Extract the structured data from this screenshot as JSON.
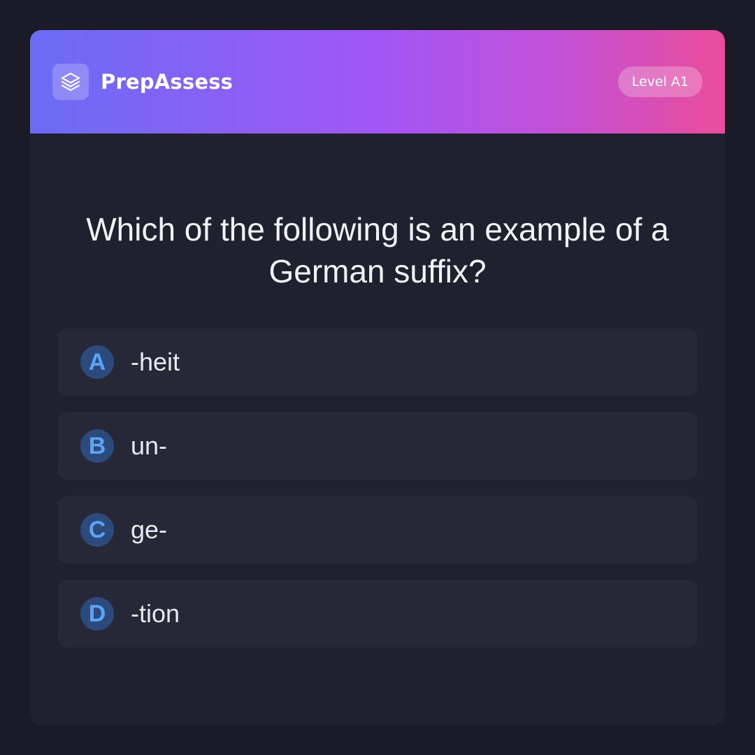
{
  "app": {
    "name": "PrepAssess",
    "logo_icon": "layers-icon",
    "level_badge": "Level A1"
  },
  "colors": {
    "background": "#1a1b26",
    "card": "#20212f",
    "option_bg": "#262837",
    "header_gradient": [
      "#6a6cf5",
      "#a256f6",
      "#ea4c9a"
    ],
    "letter_bg": "#2d4a7c",
    "letter_fg": "#59a4f5"
  },
  "quiz": {
    "question": "Which of the following is an example of a German suffix?",
    "options": [
      {
        "letter": "A",
        "text": "-heit"
      },
      {
        "letter": "B",
        "text": "un-"
      },
      {
        "letter": "C",
        "text": "ge-"
      },
      {
        "letter": "D",
        "text": "-tion"
      }
    ]
  }
}
